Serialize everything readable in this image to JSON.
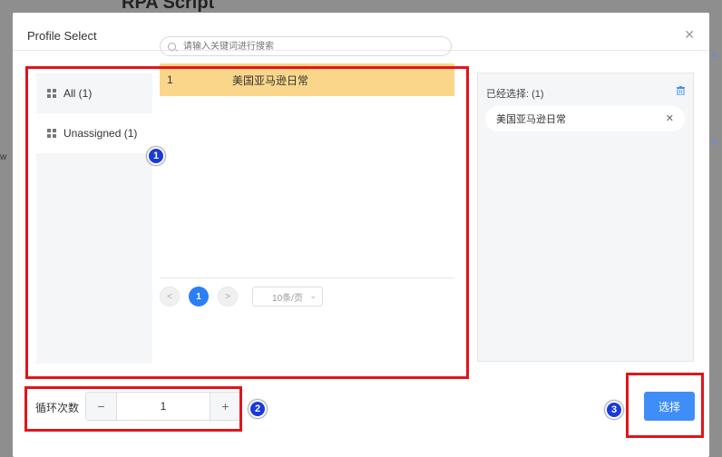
{
  "background": {
    "title": "RPA Script",
    "side_text": "w"
  },
  "dialog": {
    "title": "Profile Select",
    "close_icon": "close-icon"
  },
  "groups": [
    {
      "label": "All (1)",
      "icon": "grid-icon"
    },
    {
      "label": "Unassigned (1)",
      "icon": "grid-icon"
    }
  ],
  "search": {
    "placeholder": "请输入关键词进行搜索",
    "icon": "search-icon"
  },
  "profiles": [
    {
      "index": "1",
      "name": "美国亚马逊日常",
      "selected": true,
      "highlight_color": "#f9d68a"
    }
  ],
  "pagination": {
    "prev": "<",
    "current": "1",
    "next": ">",
    "page_size": "10条/页"
  },
  "selected": {
    "title": "已经选择: (1)",
    "items": [
      {
        "name": "美国亚马逊日常"
      }
    ],
    "clear_icon": "trash-icon"
  },
  "loop": {
    "label": "循环次数",
    "minus": "−",
    "value": "1",
    "plus": "+"
  },
  "actions": {
    "select_label": "选择",
    "accent": "#3f8ef8"
  },
  "annotations": {
    "badge_1": "1",
    "badge_2": "2",
    "badge_3": "3",
    "box_color": "#e0151a"
  }
}
